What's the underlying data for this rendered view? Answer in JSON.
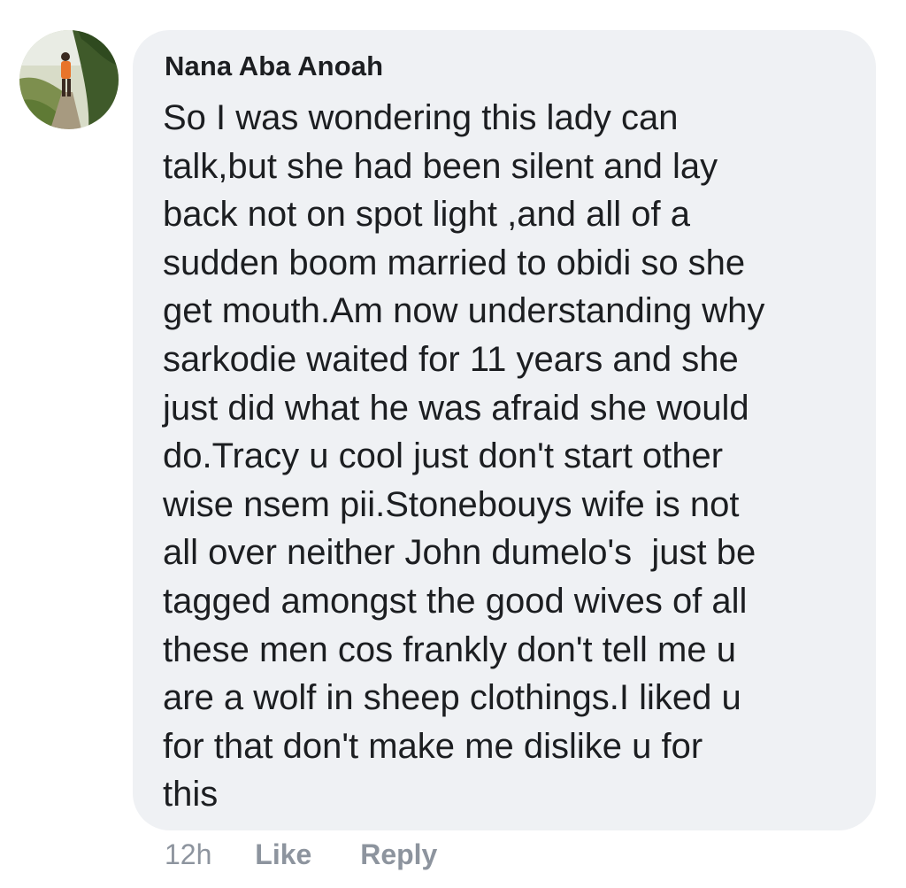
{
  "comment": {
    "author": "Nana Aba Anoah",
    "avatar_icon": "profile-photo-avatar",
    "body_lines": [
      "So I was wondering this lady can",
      "talk,but she had been silent and lay",
      "back not on spot light ,and all of a",
      "sudden boom married to obidi so she",
      "get mouth.Am now understanding why",
      "sarkodie waited for 11 years and she",
      "just did what he was afraid she would",
      "do.Tracy u cool just don't start other",
      "wise nsem pii.Stonebouys wife is not",
      "all over neither John dumelo's  just be",
      "tagged amongst the good wives of all",
      "these men cos frankly don't tell me u",
      "are a wolf in sheep clothings.I liked u",
      "for that don't make me dislike u for",
      "this"
    ],
    "bubble_color": "#eff1f4",
    "text_color": "#1c1e21"
  },
  "actions": {
    "time": "12h",
    "like_label": "Like",
    "reply_label": "Reply",
    "color": "#8d949e"
  }
}
